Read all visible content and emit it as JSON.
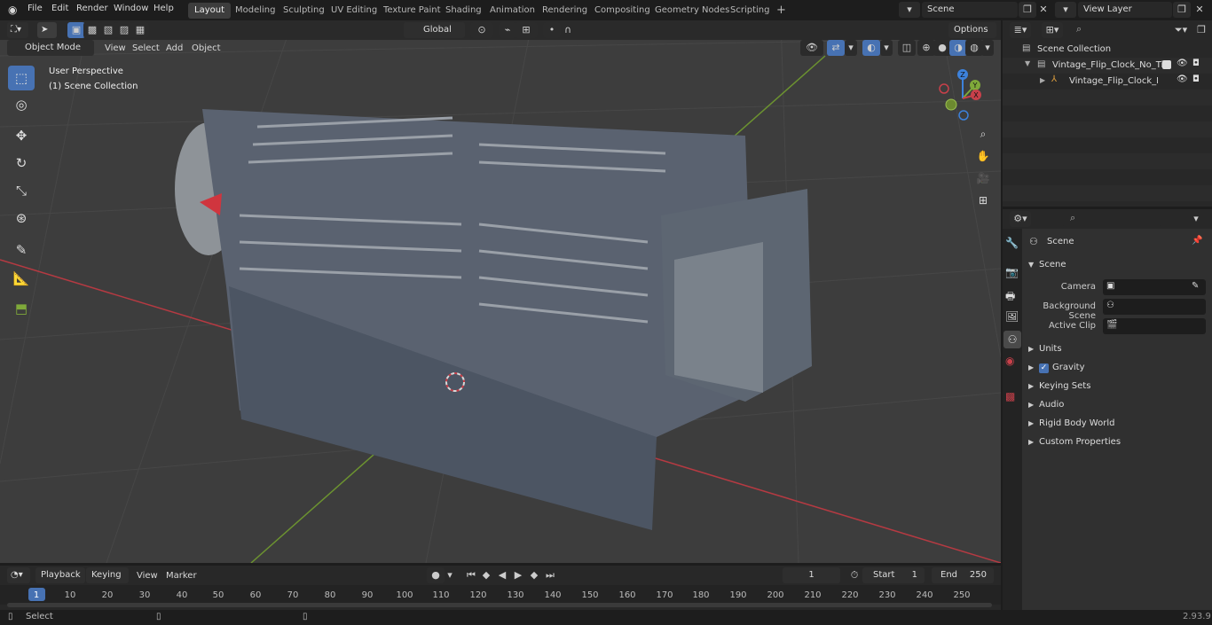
{
  "menu": {
    "file": "File",
    "edit": "Edit",
    "render": "Render",
    "window": "Window",
    "help": "Help"
  },
  "workspaces": [
    "Layout",
    "Modeling",
    "Sculpting",
    "UV Editing",
    "Texture Paint",
    "Shading",
    "Animation",
    "Rendering",
    "Compositing",
    "Geometry Nodes",
    "Scripting"
  ],
  "scene_field": "Scene",
  "view_layer_field": "View Layer",
  "viewport_header": {
    "mode": "Object Mode",
    "view": "View",
    "select": "Select",
    "add": "Add",
    "object": "Object",
    "transform_orientation": "Global",
    "options": "Options"
  },
  "viewport_overlay": {
    "perspective": "User Perspective",
    "collection": "(1) Scene Collection"
  },
  "gizmo": {
    "x": "X",
    "y": "Y",
    "z": "Z"
  },
  "outliner": {
    "root": "Scene Collection",
    "items": [
      {
        "label": "Vintage_Flip_Clock_No_Time_"
      },
      {
        "label": "Vintage_Flip_Clock_No_T"
      }
    ]
  },
  "properties": {
    "header": "Scene",
    "section": "Scene",
    "fields": [
      {
        "label": "Camera"
      },
      {
        "label": "Background Scene"
      },
      {
        "label": "Active Clip"
      }
    ],
    "panels": [
      "Units",
      "Gravity",
      "Keying Sets",
      "Audio",
      "Rigid Body World",
      "Custom Properties"
    ]
  },
  "timeline": {
    "playback": "Playback",
    "keying": "Keying",
    "view": "View",
    "marker": "Marker",
    "current_frame": "1",
    "start_label": "Start",
    "start": "1",
    "end_label": "End",
    "end": "250",
    "ticks": [
      "1",
      "10",
      "20",
      "30",
      "40",
      "50",
      "60",
      "70",
      "80",
      "90",
      "100",
      "110",
      "120",
      "130",
      "140",
      "150",
      "160",
      "170",
      "180",
      "190",
      "200",
      "210",
      "220",
      "230",
      "240",
      "250"
    ]
  },
  "status": {
    "select": "Select",
    "version": "2.93.9"
  },
  "colors": {
    "accent": "#4772b3",
    "x_axis": "#c8404a",
    "y_axis": "#7fa93a",
    "z_axis": "#3d82dc"
  }
}
